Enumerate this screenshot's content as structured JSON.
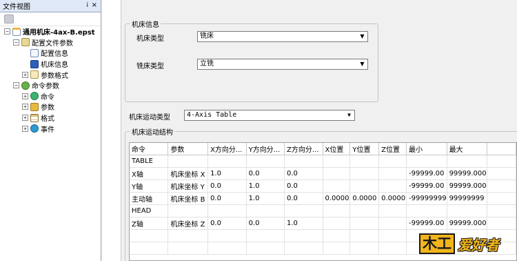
{
  "left_panel": {
    "title": "文件视图",
    "pin_glyph": "ⅰ",
    "close_glyph": "×",
    "tree": [
      {
        "label": "通用机床-4ax-B.epst",
        "level": 0,
        "expander": "−",
        "icon": "file-icon",
        "bold": true
      },
      {
        "label": "配置文件参数",
        "level": 1,
        "expander": "−",
        "icon": "config-folder-icon",
        "bold": false
      },
      {
        "label": "配置信息",
        "level": 2,
        "expander": "",
        "icon": "document-icon",
        "bold": false
      },
      {
        "label": "机床信息",
        "level": 2,
        "expander": "",
        "icon": "machine-icon",
        "bold": false
      },
      {
        "label": "参数格式",
        "level": 2,
        "expander": "+",
        "icon": "format-icon",
        "bold": false
      },
      {
        "label": "命令参数",
        "level": 1,
        "expander": "−",
        "icon": "command-params-icon",
        "bold": false
      },
      {
        "label": "命令",
        "level": 2,
        "expander": "+",
        "icon": "green-circle-icon",
        "bold": false
      },
      {
        "label": "参数",
        "level": 2,
        "expander": "+",
        "icon": "parameter-icon",
        "bold": false
      },
      {
        "label": "格式",
        "level": 2,
        "expander": "+",
        "icon": "list-icon",
        "bold": false
      },
      {
        "label": "事件",
        "level": 2,
        "expander": "+",
        "icon": "event-icon",
        "bold": false
      }
    ]
  },
  "machine_info": {
    "group_title": "机床信息",
    "machine_type_label": "机床类型",
    "machine_type_value": "铣床",
    "mill_type_label": "铣床类型",
    "mill_type_value": "立铣"
  },
  "motion": {
    "type_label": "机床运动类型",
    "type_value": "4-Axis Table",
    "structure_title": "机床运动结构"
  },
  "table": {
    "columns": [
      "命令",
      "参数",
      "X方向分...",
      "Y方向分...",
      "Z方向分...",
      "X位置",
      "Y位置",
      "Z位置",
      "最小",
      "最大"
    ],
    "rows": [
      [
        "TABLE",
        "",
        "",
        "",
        "",
        "",
        "",
        "",
        "",
        ""
      ],
      [
        "X轴",
        "机床坐标 X",
        "1.0",
        "0.0",
        "0.0",
        "",
        "",
        "",
        "-99999.00",
        "99999.000"
      ],
      [
        "Y轴",
        "机床坐标 Y",
        "0.0",
        "1.0",
        "0.0",
        "",
        "",
        "",
        "-99999.00",
        "99999.000"
      ],
      [
        "主动轴",
        "机床坐标 B",
        "0.0",
        "1.0",
        "0.0",
        "0.0000",
        "0.0000",
        "0.0000",
        "-99999999",
        "99999999"
      ],
      [
        "HEAD",
        "",
        "",
        "",
        "",
        "",
        "",
        "",
        "",
        ""
      ],
      [
        "Z轴",
        "机床坐标 Z",
        "0.0",
        "0.0",
        "1.0",
        "",
        "",
        "",
        "-99999.00",
        "99999.000"
      ],
      [
        "",
        "",
        "",
        "",
        "",
        "",
        "",
        "",
        "",
        ""
      ],
      [
        "",
        "",
        "",
        "",
        "",
        "",
        "",
        "",
        "",
        ""
      ]
    ]
  },
  "logo": {
    "mark": "木工",
    "text": "爱好者"
  },
  "colors": {
    "panel_header": "#dfe8f6",
    "logo_yellow": "#f2b51b"
  }
}
